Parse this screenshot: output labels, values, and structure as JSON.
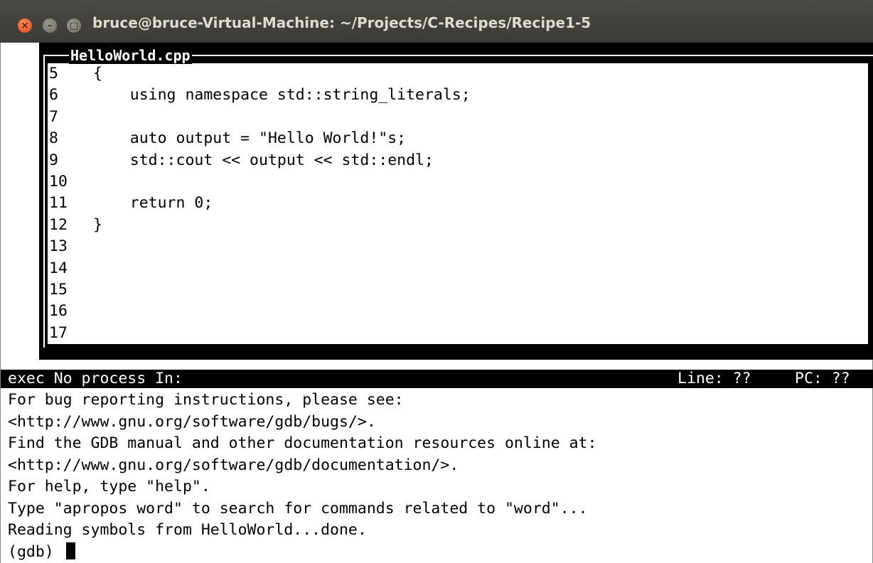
{
  "window": {
    "title": "bruce@bruce-Virtual-Machine: ~/Projects/C-Recipes/Recipe1-5",
    "buttons": {
      "close_icon": "×",
      "minimize_icon": "–",
      "maximize_icon": "□"
    }
  },
  "source": {
    "filename": "HelloWorld.cpp",
    "lines": [
      {
        "num": "5",
        "code": "        {"
      },
      {
        "num": "6",
        "code": "            using namespace std::string_literals;"
      },
      {
        "num": "7",
        "code": ""
      },
      {
        "num": "8",
        "code": "            auto output = \"Hello World!\"s;"
      },
      {
        "num": "9",
        "code": "            std::cout << output << std::endl;"
      },
      {
        "num": "10",
        "code": ""
      },
      {
        "num": "11",
        "code": "            return 0;"
      },
      {
        "num": "12",
        "code": "        }"
      },
      {
        "num": "13",
        "code": ""
      },
      {
        "num": "14",
        "code": ""
      },
      {
        "num": "15",
        "code": ""
      },
      {
        "num": "16",
        "code": ""
      },
      {
        "num": "17",
        "code": ""
      }
    ]
  },
  "status": {
    "left": "exec No process In:",
    "line": "Line: ??",
    "pc": "PC: ??"
  },
  "output": {
    "lines": [
      "For bug reporting instructions, please see:",
      "<http://www.gnu.org/software/gdb/bugs/>.",
      "Find the GDB manual and other documentation resources online at:",
      "<http://www.gnu.org/software/gdb/documentation/>.",
      "For help, type \"help\".",
      "Type \"apropos word\" to search for commands related to \"word\"...",
      "Reading symbols from HelloWorld...done."
    ],
    "prompt": "(gdb) "
  }
}
